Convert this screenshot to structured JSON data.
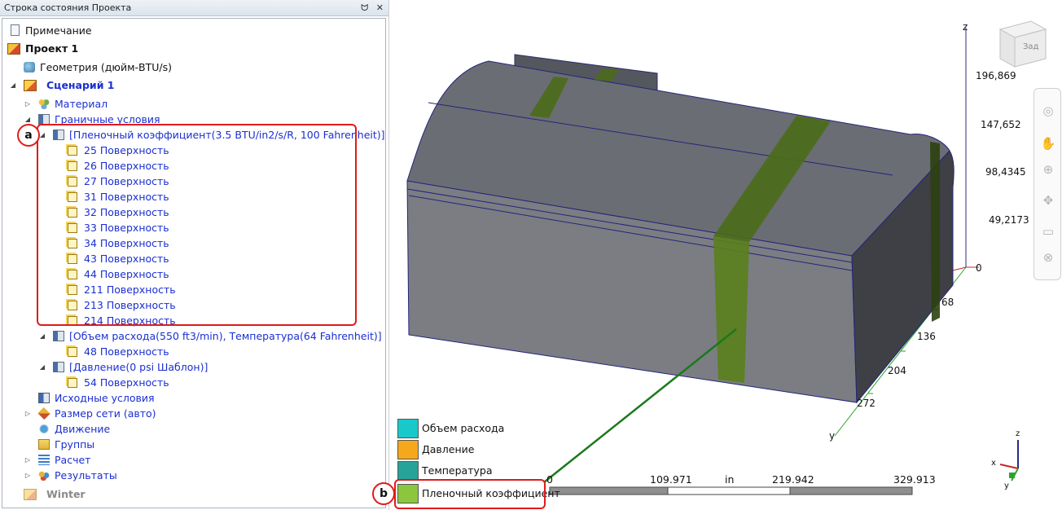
{
  "panel": {
    "title": "Строка состояния Проекта",
    "pin_glyph": "ᗢ",
    "close_glyph": "✕"
  },
  "tree": {
    "note": "Примечание",
    "project": "Проект 1",
    "geometry": "Геометрия (дюйм-BTU/s)",
    "scenario": "Сценарий 1",
    "material": "Материал",
    "boundary_conditions": "Граничные условия",
    "bc1": "[Пленочный коэффициент(3.5 BTU/in2/s/R, 100 Fahrenheit)]",
    "bc1_surfaces": [
      "25 Поверхность",
      "26 Поверхность",
      "27 Поверхность",
      "31 Поверхность",
      "32 Поверхность",
      "33 Поверхность",
      "34 Поверхность",
      "43 Поверхность",
      "44 Поверхность",
      "211 Поверхность",
      "213 Поверхность",
      "214 Поверхность"
    ],
    "bc2": "[Объем расхода(550 ft3/min), Температура(64 Fahrenheit)]",
    "bc2_surfaces": [
      "48 Поверхность"
    ],
    "bc3": "[Давление(0 psi Шаблон)]",
    "bc3_surfaces": [
      "54 Поверхность"
    ],
    "initial_conditions": "Исходные условия",
    "mesh_size": "Размер сети (авто)",
    "motion": "Движение",
    "groups": "Группы",
    "calculation": "Расчет",
    "results": "Результаты",
    "winter": "Winter"
  },
  "callouts": {
    "a": "a",
    "b": "b"
  },
  "legend": [
    {
      "label": "Объем расхода",
      "color": "#19c9c9"
    },
    {
      "label": "Давление",
      "color": "#f5a81c"
    },
    {
      "label": "Температура",
      "color": "#27a39a"
    },
    {
      "label": "Пленочный коэффициент",
      "color": "#8cc63f"
    }
  ],
  "scale": {
    "ticks": [
      "0",
      "109.971",
      "219.942",
      "329.913"
    ],
    "unit": "in"
  },
  "axis_z_ticks": [
    "196,869",
    "147,652",
    "98,4345",
    "49,2173",
    "0"
  ],
  "axis_y_ticks": [
    "68",
    "136",
    "204",
    "272"
  ],
  "axis_names": {
    "x": "x",
    "y": "y",
    "z": "z"
  },
  "view_cube_label": "Зад",
  "nav_icons": [
    "steering-wheel",
    "pan",
    "zoom",
    "orbit",
    "look",
    "walk"
  ]
}
